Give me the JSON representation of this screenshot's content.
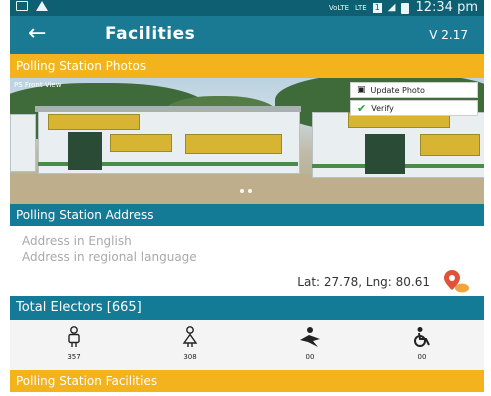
{
  "status_bar": {
    "left_icons": [
      "screen-icon",
      "warning-icon"
    ],
    "network": "VoLTE",
    "lte": "LTE",
    "sim_badge": "1",
    "time": "12:34 pm"
  },
  "app_bar": {
    "title": "Facilities",
    "version": "V 2.17"
  },
  "photos_section": {
    "header": "Polling Station Photos",
    "photo_label": "PS Front View",
    "update_photo_label": "Update Photo",
    "verify_label": "Verify"
  },
  "address_section": {
    "header": "Polling Station Address",
    "address_english_placeholder": "Address in English",
    "address_regional_placeholder": "Address in regional language",
    "latlng": "Lat: 27.78, Lng: 80.61"
  },
  "electors_section": {
    "header": "Total Electors [665]",
    "items": [
      {
        "icon": "male-voter-icon",
        "count": "357"
      },
      {
        "icon": "female-voter-icon",
        "count": "308"
      },
      {
        "icon": "third-gender-icon",
        "count": "00"
      },
      {
        "icon": "pwd-wheelchair-icon",
        "count": "00"
      }
    ]
  },
  "facilities_section": {
    "header": "Polling Station Facilities"
  },
  "colors": {
    "primary": "#1a7a93",
    "section_teal": "#137b96",
    "section_yellow": "#f2b31d"
  }
}
